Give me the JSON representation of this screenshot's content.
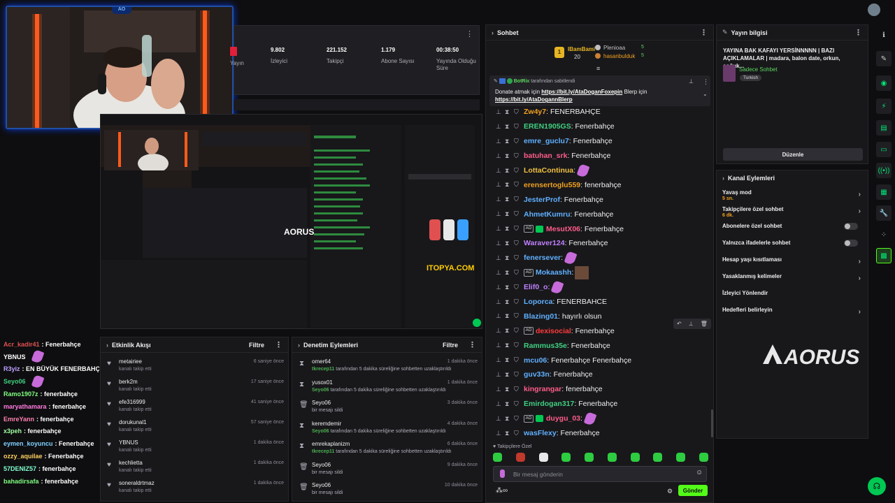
{
  "stats": [
    {
      "value": "",
      "label": "Yayın"
    },
    {
      "value": "9.802",
      "label": "İzleyici"
    },
    {
      "value": "221.152",
      "label": "Takipçi"
    },
    {
      "value": "1.179",
      "label": "Abone Sayısı"
    },
    {
      "value": "00:38:50",
      "label": "Yayında Olduğu Süre"
    }
  ],
  "overlay_chat": [
    {
      "name": "Acr_kadir41",
      "text": ": Fenerbahçe",
      "color": "#e05050"
    },
    {
      "name": "YBNUS",
      "text": "",
      "color": "#ffffff",
      "emote": true
    },
    {
      "name": "R3yiz",
      "text": ": EN BÜYÜK FENERBAHÇE MK",
      "color": "#c0a0ff"
    },
    {
      "name": "Seyo06",
      "text": "",
      "color": "#40d080",
      "emote": true
    },
    {
      "name": "Ramo1907z",
      "text": ": fenerbahçe",
      "color": "#80ff80"
    },
    {
      "name": "maryathamara",
      "text": ": fenerbahçe",
      "color": "#ff7adf"
    },
    {
      "name": "EmreYann",
      "text": ": fenerbahçe",
      "color": "#ff80b0"
    },
    {
      "name": "x3peh",
      "text": ": fenerbahçe",
      "color": "#a0ffa0"
    },
    {
      "name": "eymen_koyuncu",
      "text": ": Fenerbahçe",
      "color": "#80d0ff"
    },
    {
      "name": "ozzy_aquilae",
      "text": ": Fenerbahçe",
      "color": "#ffd060"
    },
    {
      "name": "57DENIZ57",
      "text": ": fenerbahçe",
      "color": "#80ffd0"
    },
    {
      "name": "bahadirsafa",
      "text": ": fenerbahçe",
      "color": "#80ff80"
    }
  ],
  "activity": {
    "title": "Etkinlik Akışı",
    "filter": "Filtre",
    "rows": [
      {
        "name": "metairiee",
        "sub": "kanalı takip etti",
        "time": "6 saniye önce"
      },
      {
        "name": "berk2m",
        "sub": "kanalı takip etti",
        "time": "17 saniye önce"
      },
      {
        "name": "efe316999",
        "sub": "kanalı takip etti",
        "time": "41 saniye önce"
      },
      {
        "name": "dorukunal1",
        "sub": "kanalı takip etti",
        "time": "57 saniye önce"
      },
      {
        "name": "YBNUS",
        "sub": "kanalı takip etti",
        "time": "1 dakika önce"
      },
      {
        "name": "kechlietta",
        "sub": "kanalı takip etti",
        "time": "1 dakika önce"
      },
      {
        "name": "soneraldrtmaz",
        "sub": "kanalı takip etti",
        "time": "1 dakika önce"
      }
    ]
  },
  "mod_actions": {
    "title": "Denetim Eylemleri",
    "filter": "Filtre",
    "rows": [
      {
        "icon": "timeout",
        "name": "omer64",
        "mod": "tkrecep11",
        "sub": " tarafından 5 dakika süreliğine sohbetten uzaklaştırıldı",
        "time": "1 dakika önce"
      },
      {
        "icon": "timeout",
        "name": "yusox01",
        "mod": "Seyo06",
        "sub": " tarafından 5 dakika süreliğine sohbetten uzaklaştırıldı",
        "time": "1 dakika önce"
      },
      {
        "icon": "trash",
        "name": "Seyo06",
        "mod": "",
        "sub": "bir mesajı sildi",
        "time": "3 dakika önce"
      },
      {
        "icon": "timeout",
        "name": "keremdemir",
        "mod": "Seyo06",
        "sub": " tarafından 5 dakika süreliğine sohbetten uzaklaştırıldı",
        "time": "4 dakika önce"
      },
      {
        "icon": "timeout",
        "name": "emrekaplanizm",
        "mod": "tkrecep11",
        "sub": " tarafından 5 dakika süreliğine sohbetten uzaklaştırıldı",
        "time": "6 dakika önce"
      },
      {
        "icon": "trash",
        "name": "Seyo06",
        "mod": "",
        "sub": "bir mesajı sildi",
        "time": "9 dakika önce"
      },
      {
        "icon": "trash",
        "name": "Seyo06",
        "mod": "",
        "sub": "bir mesajı sildi",
        "time": "10 dakika önce"
      }
    ]
  },
  "chat": {
    "title": "Sohbet",
    "leaders": [
      {
        "name": "IBamBami",
        "count": "20"
      },
      {
        "name": "Plenioaa",
        "count": "5"
      },
      {
        "name": "hasanbulduk",
        "count": "5"
      }
    ],
    "pinned": {
      "bot": "BotRix",
      "by": "tarafından sabitlendi",
      "text1": "Donate atmak için ",
      "link1": "https://bit.ly/AtaDoganFoxepin",
      "text2": " Blerp için ",
      "link2": "https://bit.ly/AtaDogannBlerp"
    },
    "messages": [
      {
        "user": "Zw4y7",
        "color": "#f0a020",
        "text": ": FENERBAHÇE"
      },
      {
        "user": "EREN1905GS",
        "color": "#40d080",
        "text": ": Fenerbahçe"
      },
      {
        "user": "emre_guclu7",
        "color": "#60b0ff",
        "text": ": Fenerbahçe"
      },
      {
        "user": "batuhan_srk",
        "color": "#ff5c8a",
        "text": ": Fenerbahçe"
      },
      {
        "user": "LottaContinua",
        "color": "#f0c040",
        "text": ":",
        "emote": true
      },
      {
        "user": "erensertoglu559",
        "color": "#f0a020",
        "text": ": fenerbahçe"
      },
      {
        "user": "JesterProf",
        "color": "#60b0ff",
        "text": ": Fenerbahçe"
      },
      {
        "user": "AhmetKumru",
        "color": "#60b0ff",
        "text": ": Fenerbahçe"
      },
      {
        "user": "MesutX06",
        "color": "#ff5c8a",
        "text": ": Fenerbahçe",
        "badges": true
      },
      {
        "user": "Waraver124",
        "color": "#c080ff",
        "text": ": Fenerbahçe"
      },
      {
        "user": "fenersever",
        "color": "#60b0ff",
        "text": ":",
        "emote": true
      },
      {
        "user": "Mokaashh",
        "color": "#60b0ff",
        "text": ":",
        "badge1": true,
        "avatar": true
      },
      {
        "user": "Elif0_o",
        "color": "#c080ff",
        "text": ":",
        "emote": true
      },
      {
        "user": "Loporca",
        "color": "#60b0ff",
        "text": ": FENERBAHCE"
      },
      {
        "user": "Blazing01",
        "color": "#60b0ff",
        "text": ": hayırlı olsun"
      },
      {
        "user": "dexisocial",
        "color": "#ff3b3b",
        "text": ": Fenerbahçe",
        "badge1": true
      },
      {
        "user": "Rammus35e",
        "color": "#40d080",
        "text": ": Fenerbahçe"
      },
      {
        "user": "mcu06",
        "color": "#60b0ff",
        "text": ": Fenerbahçe Fenerbahçe"
      },
      {
        "user": "guv33n",
        "color": "#60b0ff",
        "text": ": Fenerbahçe"
      },
      {
        "user": "kingrangar",
        "color": "#ff5c8a",
        "text": ": fenerbahçe"
      },
      {
        "user": "Emirdogan317",
        "color": "#40d080",
        "text": ": Fenerbahçe"
      },
      {
        "user": "duygu_03",
        "color": "#ff5c8a",
        "text": ":",
        "emote": true,
        "badges": true
      },
      {
        "user": "wasFlexy",
        "color": "#60b0ff",
        "text": ": Fenerbahçe"
      }
    ],
    "followers_only": "Takipçilere Özel",
    "input_placeholder": "Bir mesaj gönderin",
    "send": "Gönder"
  },
  "stream_info": {
    "title": "Yayın bilgisi",
    "stream_title": "YAYINA BAK KAFAYI YERSİNNNNN | BAZI AÇIKLAMALAR | madara, balon date, orkun, soğuk...",
    "category": "Sadece Sohbet",
    "tag": "Turkish",
    "edit": "Düzenle"
  },
  "channel_actions": {
    "title": "Kanal Eylemleri",
    "items": [
      {
        "label": "Yavaş mod",
        "sub": "5 sn.",
        "control": "chevron"
      },
      {
        "label": "Takipçilere özel sohbet",
        "sub": "6 dk.",
        "control": "chevron"
      },
      {
        "label": "Abonelere özel sohbet",
        "sub": "",
        "control": "toggle"
      },
      {
        "label": "Yalnızca ifadelerle sohbet",
        "sub": "",
        "control": "toggle"
      },
      {
        "label": "Hesap yaşı kısıtlaması",
        "sub": "",
        "control": "chevron"
      },
      {
        "label": "Yasaklanmış kelimeler",
        "sub": "",
        "control": "chevron"
      },
      {
        "label": "İzleyici Yönlendir",
        "sub": "",
        "control": "none"
      },
      {
        "label": "Hedefleri belirleyin",
        "sub": "",
        "control": "chevron"
      }
    ]
  },
  "logo_text": "AORUS",
  "colors": {
    "accent": "#53fc18",
    "brand": "#00e676",
    "background": "#0e0e10"
  }
}
